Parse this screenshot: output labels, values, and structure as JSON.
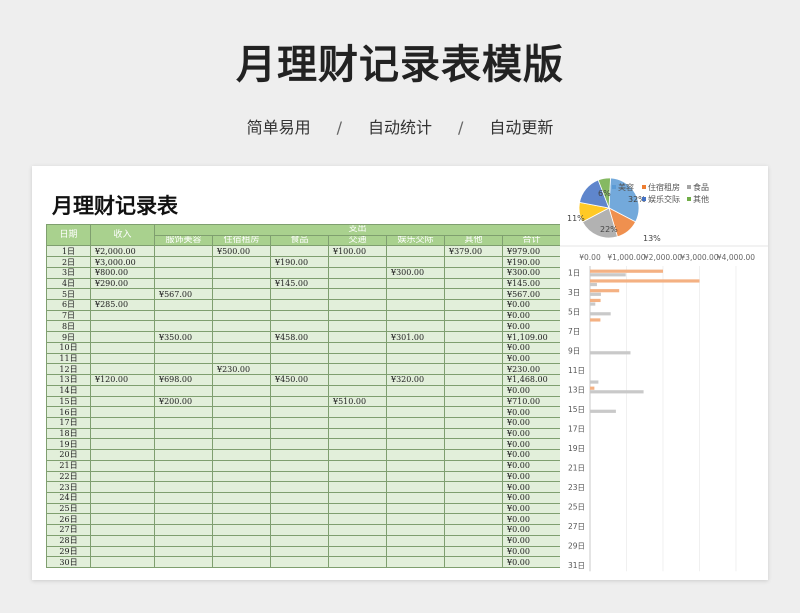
{
  "hero": {
    "title": "月理财记录表模版",
    "tags": [
      "简单易用",
      "自动统计",
      "自动更新"
    ],
    "separator": "/"
  },
  "sheet": {
    "title": "月理财记录表"
  },
  "table": {
    "col_date": "日期",
    "col_income": "收入",
    "col_expense_group": "支出",
    "expense_cols": [
      "服饰美容",
      "住宿租房",
      "食品",
      "交通",
      "娱乐交际",
      "其他"
    ],
    "col_total": "合计",
    "rows": [
      {
        "day": "1日",
        "income": "¥2,000.00",
        "e": [
          "",
          "¥500.00",
          "",
          "¥100.00",
          "",
          "¥379.00"
        ],
        "total": "¥979.00"
      },
      {
        "day": "2日",
        "income": "¥3,000.00",
        "e": [
          "",
          "",
          "¥190.00",
          "",
          "",
          ""
        ],
        "total": "¥190.00"
      },
      {
        "day": "3日",
        "income": "¥800.00",
        "e": [
          "",
          "",
          "",
          "",
          "¥300.00",
          ""
        ],
        "total": "¥300.00"
      },
      {
        "day": "4日",
        "income": "¥290.00",
        "e": [
          "",
          "",
          "¥145.00",
          "",
          "",
          ""
        ],
        "total": "¥145.00"
      },
      {
        "day": "5日",
        "income": "",
        "e": [
          "¥567.00",
          "",
          "",
          "",
          "",
          ""
        ],
        "total": "¥567.00"
      },
      {
        "day": "6日",
        "income": "¥285.00",
        "e": [
          "",
          "",
          "",
          "",
          "",
          ""
        ],
        "total": "¥0.00"
      },
      {
        "day": "7日",
        "income": "",
        "e": [
          "",
          "",
          "",
          "",
          "",
          ""
        ],
        "total": "¥0.00"
      },
      {
        "day": "8日",
        "income": "",
        "e": [
          "",
          "",
          "",
          "",
          "",
          ""
        ],
        "total": "¥0.00"
      },
      {
        "day": "9日",
        "income": "",
        "e": [
          "¥350.00",
          "",
          "¥458.00",
          "",
          "¥301.00",
          ""
        ],
        "total": "¥1,109.00"
      },
      {
        "day": "10日",
        "income": "",
        "e": [
          "",
          "",
          "",
          "",
          "",
          ""
        ],
        "total": "¥0.00"
      },
      {
        "day": "11日",
        "income": "",
        "e": [
          "",
          "",
          "",
          "",
          "",
          ""
        ],
        "total": "¥0.00"
      },
      {
        "day": "12日",
        "income": "",
        "e": [
          "",
          "¥230.00",
          "",
          "",
          "",
          ""
        ],
        "total": "¥230.00"
      },
      {
        "day": "13日",
        "income": "¥120.00",
        "e": [
          "¥698.00",
          "",
          "¥450.00",
          "",
          "¥320.00",
          ""
        ],
        "total": "¥1,468.00"
      },
      {
        "day": "14日",
        "income": "",
        "e": [
          "",
          "",
          "",
          "",
          "",
          ""
        ],
        "total": "¥0.00"
      },
      {
        "day": "15日",
        "income": "",
        "e": [
          "¥200.00",
          "",
          "",
          "¥510.00",
          "",
          ""
        ],
        "total": "¥710.00"
      },
      {
        "day": "16日",
        "income": "",
        "e": [
          "",
          "",
          "",
          "",
          "",
          ""
        ],
        "total": "¥0.00"
      },
      {
        "day": "17日",
        "income": "",
        "e": [
          "",
          "",
          "",
          "",
          "",
          ""
        ],
        "total": "¥0.00"
      },
      {
        "day": "18日",
        "income": "",
        "e": [
          "",
          "",
          "",
          "",
          "",
          ""
        ],
        "total": "¥0.00"
      },
      {
        "day": "19日",
        "income": "",
        "e": [
          "",
          "",
          "",
          "",
          "",
          ""
        ],
        "total": "¥0.00"
      },
      {
        "day": "20日",
        "income": "",
        "e": [
          "",
          "",
          "",
          "",
          "",
          ""
        ],
        "total": "¥0.00"
      },
      {
        "day": "21日",
        "income": "",
        "e": [
          "",
          "",
          "",
          "",
          "",
          ""
        ],
        "total": "¥0.00"
      },
      {
        "day": "22日",
        "income": "",
        "e": [
          "",
          "",
          "",
          "",
          "",
          ""
        ],
        "total": "¥0.00"
      },
      {
        "day": "23日",
        "income": "",
        "e": [
          "",
          "",
          "",
          "",
          "",
          ""
        ],
        "total": "¥0.00"
      },
      {
        "day": "24日",
        "income": "",
        "e": [
          "",
          "",
          "",
          "",
          "",
          ""
        ],
        "total": "¥0.00"
      },
      {
        "day": "25日",
        "income": "",
        "e": [
          "",
          "",
          "",
          "",
          "",
          ""
        ],
        "total": "¥0.00"
      },
      {
        "day": "26日",
        "income": "",
        "e": [
          "",
          "",
          "",
          "",
          "",
          ""
        ],
        "total": "¥0.00"
      },
      {
        "day": "27日",
        "income": "",
        "e": [
          "",
          "",
          "",
          "",
          "",
          ""
        ],
        "total": "¥0.00"
      },
      {
        "day": "28日",
        "income": "",
        "e": [
          "",
          "",
          "",
          "",
          "",
          ""
        ],
        "total": "¥0.00"
      },
      {
        "day": "29日",
        "income": "",
        "e": [
          "",
          "",
          "",
          "",
          "",
          ""
        ],
        "total": "¥0.00"
      },
      {
        "day": "30日",
        "income": "",
        "e": [
          "",
          "",
          "",
          "",
          "",
          ""
        ],
        "total": "¥0.00"
      }
    ]
  },
  "chart_data": [
    {
      "type": "pie",
      "categories": [
        "服饰美容",
        "住宿租房",
        "食品",
        "交通",
        "娱乐交际",
        "其他"
      ],
      "values": [
        1815,
        730,
        1243,
        610,
        921,
        379
      ],
      "slice_labels": [
        "32%",
        "13%",
        "22%",
        "11%",
        "16%",
        "7%"
      ],
      "visible_labels": [
        "32%",
        "13%",
        "22%",
        "11%",
        "6%"
      ],
      "legend": [
        "服饰美容",
        "住宿租房",
        "食品",
        "交通",
        "娱乐交际",
        "其他"
      ],
      "legend_visible": [
        "美容",
        "住宿租房",
        "食品",
        "娱乐交际",
        "其他"
      ],
      "colors": [
        "#5b9bd5",
        "#ed7d31",
        "#a5a5a5",
        "#ffc000",
        "#4472c4",
        "#70ad47"
      ]
    },
    {
      "type": "bar",
      "orientation": "horizontal",
      "categories": [
        "1日",
        "2日",
        "3日",
        "4日",
        "5日",
        "6日",
        "7日",
        "8日",
        "9日",
        "10日",
        "11日",
        "12日",
        "13日",
        "14日",
        "15日",
        "16日",
        "17日",
        "18日",
        "19日",
        "20日",
        "21日",
        "22日",
        "23日",
        "24日",
        "25日",
        "26日",
        "27日",
        "28日",
        "29日",
        "30日",
        "31日"
      ],
      "category_labels_visible": [
        "1日",
        "3日",
        "5日",
        "7日",
        "9日",
        "11日",
        "13日",
        "15日",
        "17日",
        "19日",
        "21日",
        "23日",
        "25日",
        "27日",
        "29日",
        "31日"
      ],
      "series": [
        {
          "values": [
            2000,
            3000,
            800,
            290,
            0,
            285,
            0,
            0,
            0,
            0,
            0,
            0,
            120,
            0,
            0,
            0,
            0,
            0,
            0,
            0,
            0,
            0,
            0,
            0,
            0,
            0,
            0,
            0,
            0,
            0,
            0
          ]
        },
        {
          "values": [
            979,
            190,
            300,
            145,
            567,
            0,
            0,
            0,
            1109,
            0,
            0,
            230,
            1468,
            0,
            710,
            0,
            0,
            0,
            0,
            0,
            0,
            0,
            0,
            0,
            0,
            0,
            0,
            0,
            0,
            0,
            0
          ]
        }
      ],
      "xlim": [
        0,
        4000
      ],
      "x_ticks": [
        "¥0.00",
        "¥1,000.00",
        "¥2,000.00",
        "¥3,000.00",
        "¥4,000.00"
      ],
      "colors": [
        "#f4b183",
        "#c9c9c9"
      ]
    }
  ]
}
